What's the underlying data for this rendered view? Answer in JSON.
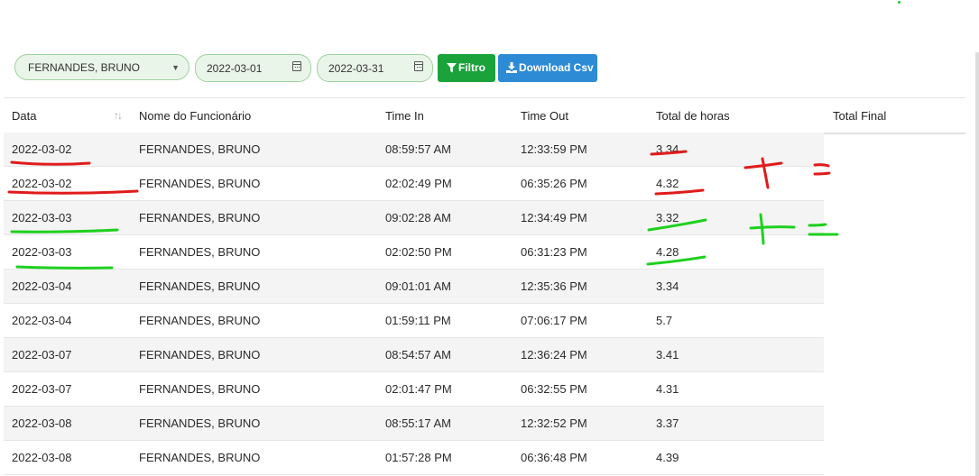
{
  "filters": {
    "employee_select": "FERNANDES, BRUNO",
    "date_from": "2022-03-01",
    "date_to": "2022-03-31",
    "filter_button": "Filtro",
    "download_button": "Download Csv"
  },
  "icons": {
    "filter": "funnel-icon",
    "download": "download-icon",
    "calendar": "calendar-icon",
    "caret": "chevron-down-icon",
    "sort": "sort-icon"
  },
  "table": {
    "columns": [
      "Data",
      "Nome do Funcionário",
      "Time In",
      "Time Out",
      "Total de horas",
      "Total Final"
    ],
    "rows": [
      [
        "2022-03-02",
        "FERNANDES, BRUNO",
        "08:59:57 AM",
        "12:33:59 PM",
        "3.34"
      ],
      [
        "2022-03-02",
        "FERNANDES, BRUNO",
        "02:02:49 PM",
        "06:35:26 PM",
        "4.32"
      ],
      [
        "2022-03-03",
        "FERNANDES, BRUNO",
        "09:02:28 AM",
        "12:34:49 PM",
        "3.32"
      ],
      [
        "2022-03-03",
        "FERNANDES, BRUNO",
        "02:02:50 PM",
        "06:31:23 PM",
        "4.28"
      ],
      [
        "2022-03-04",
        "FERNANDES, BRUNO",
        "09:01:01 AM",
        "12:35:36 PM",
        "3.34"
      ],
      [
        "2022-03-04",
        "FERNANDES, BRUNO",
        "01:59:11 PM",
        "07:06:17 PM",
        "5.7"
      ],
      [
        "2022-03-07",
        "FERNANDES, BRUNO",
        "08:54:57 AM",
        "12:36:24 PM",
        "3.41"
      ],
      [
        "2022-03-07",
        "FERNANDES, BRUNO",
        "02:01:47 PM",
        "06:32:55 PM",
        "4.31"
      ],
      [
        "2022-03-08",
        "FERNANDES, BRUNO",
        "08:55:17 AM",
        "12:32:52 PM",
        "3.37"
      ],
      [
        "2022-03-08",
        "FERNANDES, BRUNO",
        "01:57:28 PM",
        "06:36:48 PM",
        "4.39"
      ]
    ]
  },
  "annotations": {
    "red": "#e01b1b",
    "green": "#1fd01f"
  }
}
